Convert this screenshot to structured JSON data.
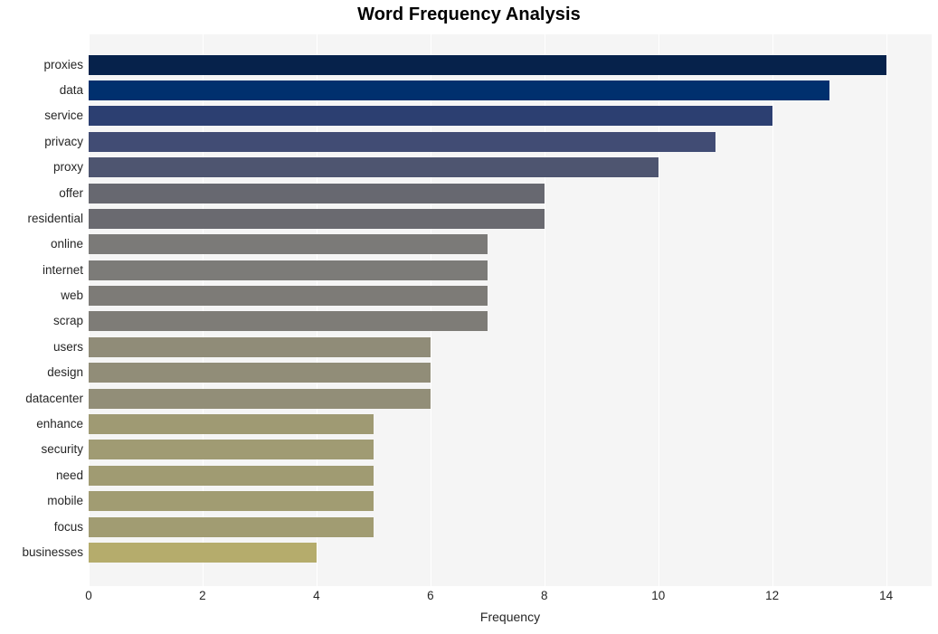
{
  "chart_data": {
    "type": "bar",
    "orientation": "horizontal",
    "title": "Word Frequency Analysis",
    "xlabel": "Frequency",
    "ylabel": "",
    "xlim": [
      0,
      14.8
    ],
    "ylim": null,
    "grid": true,
    "legend": null,
    "x_ticks": [
      "0",
      "2",
      "4",
      "6",
      "8",
      "10",
      "12",
      "14"
    ],
    "x_tick_values": [
      0,
      2,
      4,
      6,
      8,
      10,
      12,
      14
    ],
    "categories": [
      "proxies",
      "data",
      "service",
      "privacy",
      "proxy",
      "offer",
      "residential",
      "online",
      "internet",
      "web",
      "scrap",
      "users",
      "design",
      "datacenter",
      "enhance",
      "security",
      "need",
      "mobile",
      "focus",
      "businesses"
    ],
    "values": [
      14,
      13,
      12,
      11,
      10,
      8,
      8,
      7,
      7,
      7,
      7,
      6,
      6,
      6,
      5,
      5,
      5,
      5,
      5,
      4
    ],
    "bar_colors": [
      "#06224b",
      "#00306e",
      "#2c3f71",
      "#414c74",
      "#4e5570",
      "#676870",
      "#6a6a70",
      "#7b7a78",
      "#7c7b78",
      "#7d7b77",
      "#7e7c77",
      "#908c78",
      "#918d78",
      "#928e78",
      "#9f9a73",
      "#a09b73",
      "#a09b72",
      "#a19c72",
      "#a19c72",
      "#b5ac6c"
    ],
    "plot_background": "#f5f5f5",
    "gridline_color": "#ffffff",
    "figure_background": "#ffffff",
    "text_color": "#262626"
  }
}
